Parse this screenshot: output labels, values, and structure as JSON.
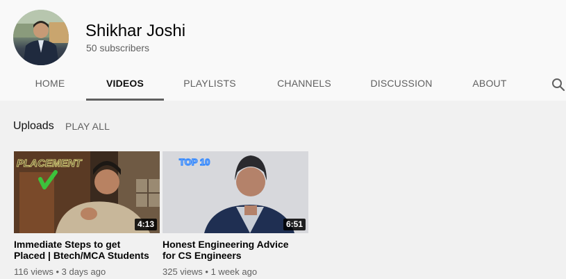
{
  "channel": {
    "name": "Shikhar Joshi",
    "subscribers": "50 subscribers"
  },
  "tabs": [
    {
      "label": "HOME"
    },
    {
      "label": "VIDEOS",
      "active": true
    },
    {
      "label": "PLAYLISTS"
    },
    {
      "label": "CHANNELS"
    },
    {
      "label": "DISCUSSION"
    },
    {
      "label": "ABOUT"
    }
  ],
  "icons": {
    "search": "search-icon"
  },
  "shelf": {
    "title": "Uploads",
    "play_all": "PLAY ALL"
  },
  "videos": [
    {
      "title": "Immediate Steps to get Placed | Btech/MCA Students",
      "duration": "4:13",
      "views": "116 views",
      "age": "3 days ago",
      "meta": "116 views • 3 days ago",
      "thumb_text": "PLACEMENT"
    },
    {
      "title": "Honest Engineering Advice for CS Engineers",
      "duration": "6:51",
      "views": "325 views",
      "age": "1 week ago",
      "meta": "325 views • 1 week ago",
      "thumb_text": "TOP 10"
    }
  ]
}
